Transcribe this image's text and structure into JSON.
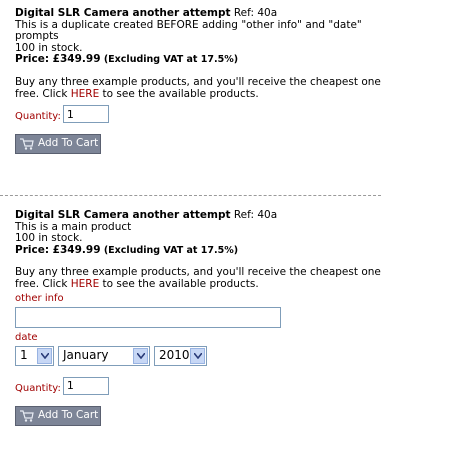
{
  "products": [
    {
      "title": "Digital SLR Camera another attempt",
      "ref": "Ref: 40a",
      "description_lines": [
        "This is a duplicate created BEFORE adding \"other info\" and \"date\"",
        "prompts"
      ],
      "stock": "100 in stock.",
      "price": "Price: £349.99",
      "price_note": "(Excluding VAT at 17.5%)",
      "offer_line1": "Buy any three example products, and you'll receive the cheapest one",
      "offer_prefix": "free. Click ",
      "offer_link": "HERE",
      "offer_suffix": " to see the available products.",
      "quantity_label": "Quantity:",
      "quantity_value": "1",
      "button_label": "Add To Cart"
    },
    {
      "title": "Digital SLR Camera another attempt",
      "ref": "Ref: 40a",
      "description_lines": [
        "This is a main product"
      ],
      "stock": "100 in stock.",
      "price": "Price: £349.99",
      "price_note": "(Excluding VAT at 17.5%)",
      "offer_line1": "Buy any three example products, and you'll receive the cheapest one",
      "offer_prefix": "free. Click ",
      "offer_link": "HERE",
      "offer_suffix": " to see the available products.",
      "other_info_label": "other info",
      "other_info_value": "",
      "date_label": "date",
      "date_day": "1",
      "date_month": "January",
      "date_year": "2010",
      "quantity_label": "Quantity:",
      "quantity_value": "1",
      "button_label": "Add To Cart"
    }
  ],
  "colors": {
    "label_red": "#a00000",
    "button_bg": "#7d8597",
    "input_border": "#7f9db9"
  }
}
